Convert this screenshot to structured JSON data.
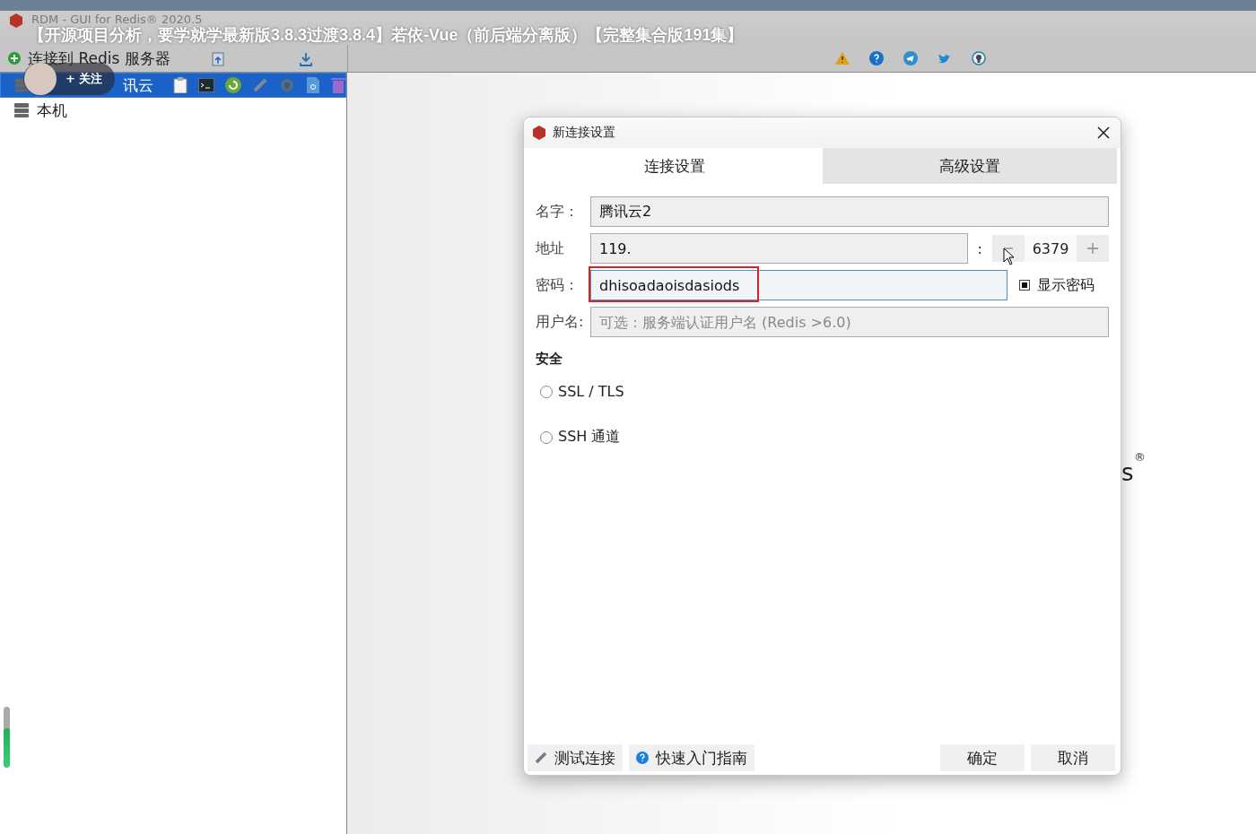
{
  "window": {
    "title": "RDM - GUI for Redis® 2020.5"
  },
  "video_overlay": {
    "title": "【开源项目分析，要学就学最新版3.8.3过渡3.8.4】若依-Vue（前后端分离版）【完整集合版191集】",
    "follow_label": "+ 关注"
  },
  "toolbar": {
    "connect_label": "连接到 Redis 服务器"
  },
  "connections": [
    {
      "name": "讯云",
      "selected": true
    },
    {
      "name": "本机",
      "selected": false
    }
  ],
  "logo": {
    "fragment": "s",
    "mark": "®"
  },
  "volume_meter": {
    "level": 0.65
  },
  "dialog": {
    "title": "新连接设置",
    "tabs": [
      {
        "label": "连接设置",
        "selected": true
      },
      {
        "label": "高级设置",
        "selected": false
      }
    ],
    "name": {
      "label": "名字：",
      "value": "腾讯云2"
    },
    "address": {
      "label": "地址",
      "value": "119.",
      "separator": ":",
      "port": "6379"
    },
    "password": {
      "label": "密码：",
      "value": "dhisoadaoisdasiods",
      "show_label": "显示密码",
      "show_checked": true
    },
    "username": {
      "label": "用户名:",
      "placeholder": "可选：服务端认证用户名 (Redis >6.0)"
    },
    "security_heading": "安全",
    "security_options": [
      {
        "label": "SSL / TLS",
        "selected": false
      },
      {
        "label": "SSH 通道",
        "selected": false
      }
    ],
    "buttons": [
      {
        "label": "测试连接",
        "kind": "test"
      },
      {
        "label": "快速入门指南",
        "kind": "help"
      },
      {
        "label": "确定",
        "kind": "plain"
      },
      {
        "label": "取消",
        "kind": "plain"
      }
    ]
  }
}
